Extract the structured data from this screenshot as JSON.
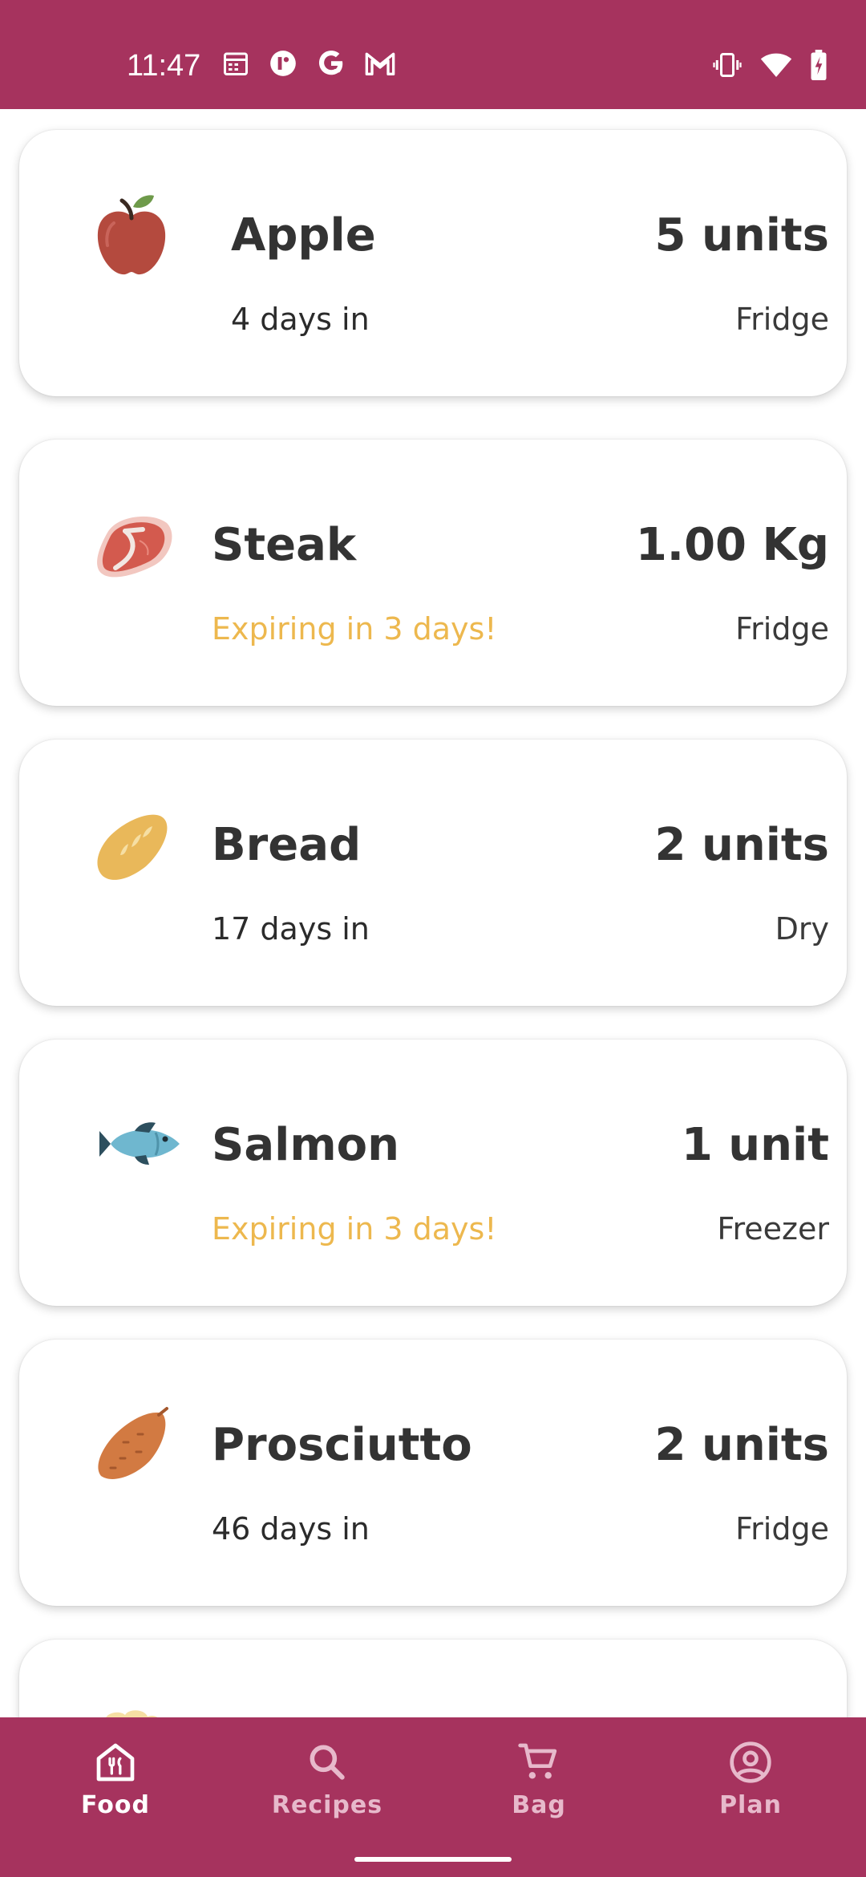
{
  "status_bar": {
    "time": "11:47",
    "left_icons": [
      "calendar-icon",
      "app-icon",
      "google-icon",
      "gmail-icon"
    ],
    "right_icons": [
      "vibrate-icon",
      "wifi-icon",
      "battery-icon"
    ],
    "background": "#A6335E"
  },
  "foods": [
    {
      "name": "Apple",
      "quantity": "5 units",
      "days": "4 days in",
      "storage": "Fridge",
      "icon": "apple-icon",
      "expiring": false
    },
    {
      "name": "Steak",
      "quantity": "1.00 Kg",
      "days": "Expiring in 3 days!",
      "storage": "Fridge",
      "icon": "steak-icon",
      "expiring": true
    },
    {
      "name": "Bread",
      "quantity": "2 units",
      "days": "17 days in",
      "storage": "Dry",
      "icon": "bread-icon",
      "expiring": false
    },
    {
      "name": "Salmon",
      "quantity": "1 unit",
      "days": "Expiring in 3 days!",
      "storage": "Freezer",
      "icon": "fish-icon",
      "expiring": true
    },
    {
      "name": "Prosciutto",
      "quantity": "2 units",
      "days": "46 days in",
      "storage": "Fridge",
      "icon": "sweet-potato-icon",
      "expiring": false
    }
  ],
  "bottom_nav": {
    "items": [
      {
        "label": "Food",
        "icon": "food-home-icon",
        "active": true
      },
      {
        "label": "Recipes",
        "icon": "search-icon",
        "active": false
      },
      {
        "label": "Bag",
        "icon": "cart-icon",
        "active": false
      },
      {
        "label": "Plan",
        "icon": "account-icon",
        "active": false
      }
    ]
  },
  "colors": {
    "primary": "#A6335E",
    "warning": "#EDB84E",
    "nav_inactive": "#E7B9CB"
  }
}
